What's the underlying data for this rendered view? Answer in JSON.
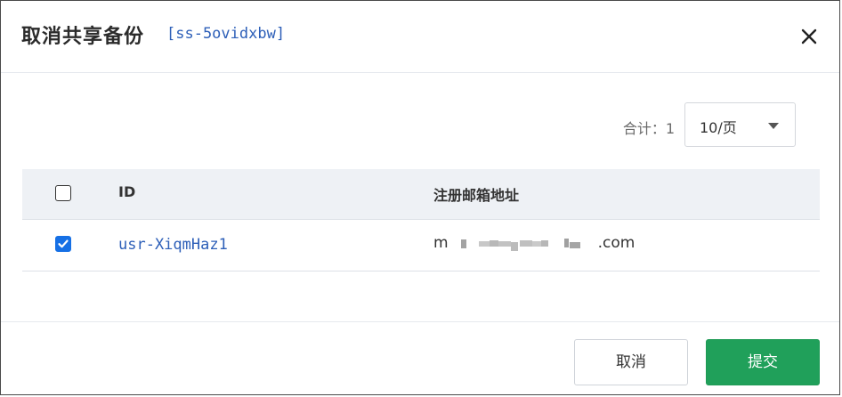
{
  "dialog": {
    "title": "取消共享备份",
    "resource_id": "[ss-5ovidxbw]",
    "close_icon": "close-icon"
  },
  "pager": {
    "total_label": "合计：1",
    "page_size": "10/页"
  },
  "table": {
    "columns": [
      "ID",
      "注册邮箱地址"
    ],
    "rows": [
      {
        "checked": true,
        "id": "usr-XiqmHaz1",
        "email_prefix": "m",
        "email_suffix": ".com"
      }
    ],
    "select_all_checked": false
  },
  "footer": {
    "cancel_label": "取消",
    "submit_label": "提交"
  },
  "colors": {
    "link": "#2d5fb8",
    "primary": "#20a05a",
    "checkbox": "#1670e5"
  }
}
